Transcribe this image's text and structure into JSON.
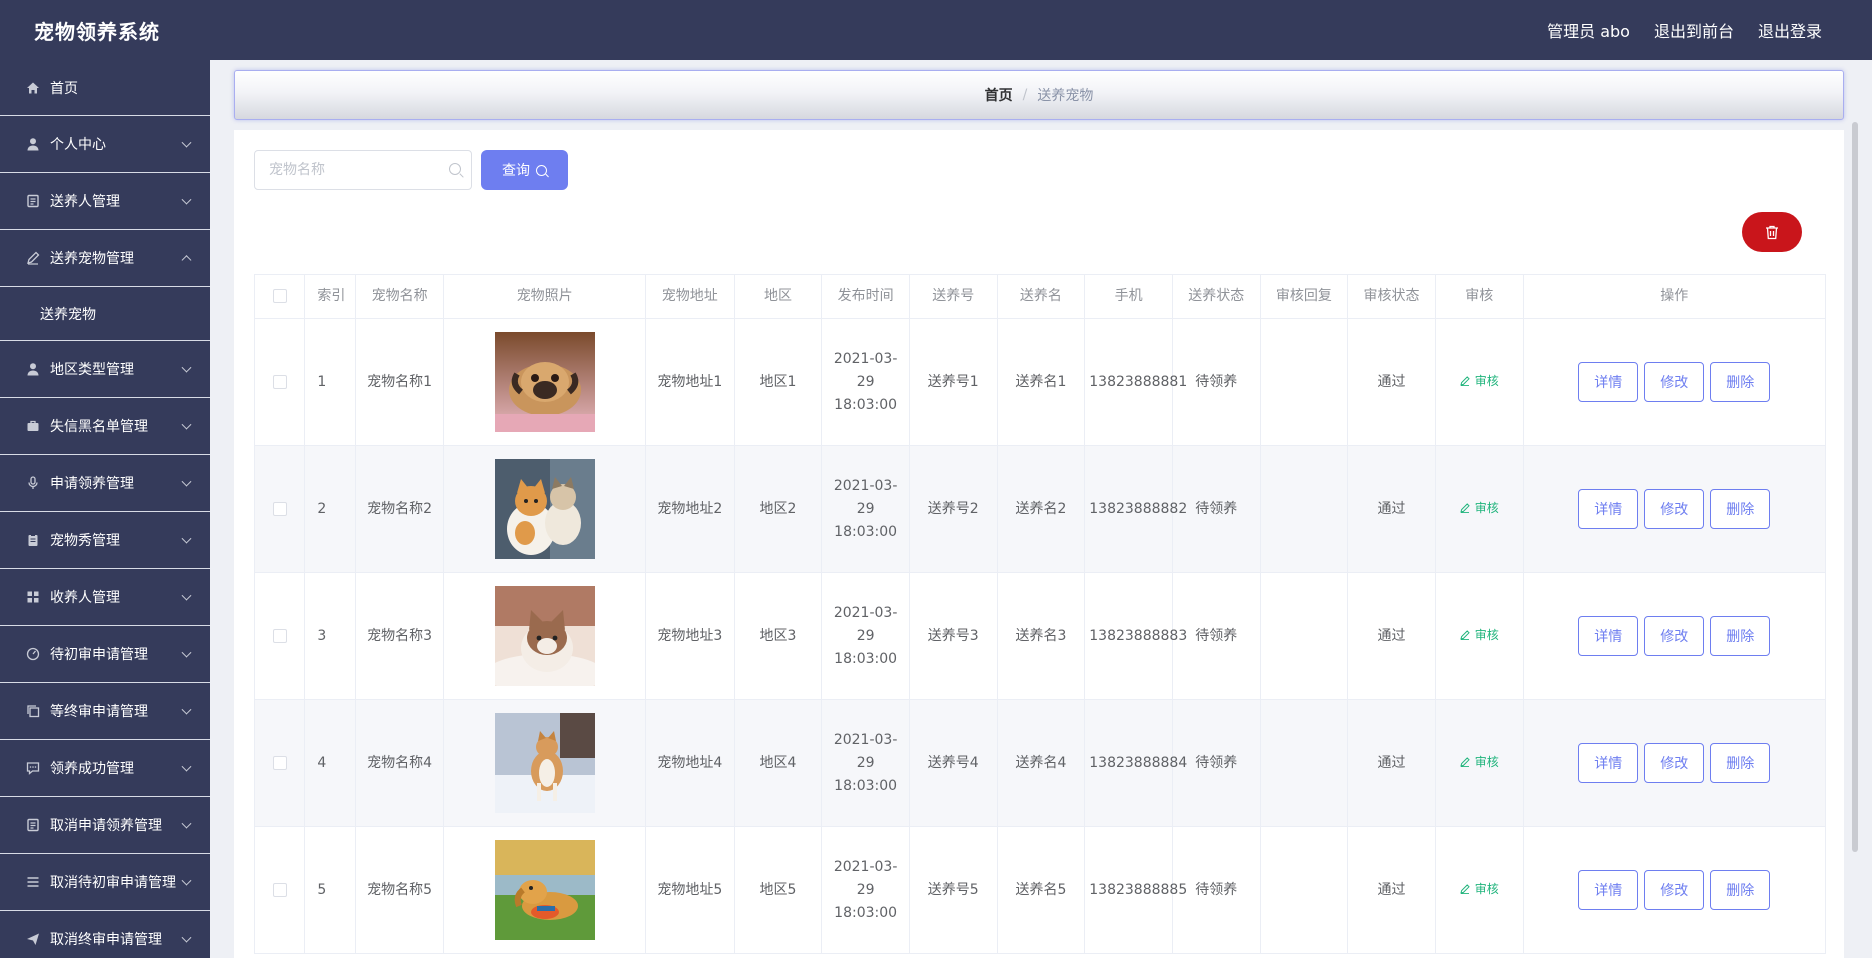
{
  "header": {
    "brand": "宠物领养系统",
    "admin_label": "管理员 abo",
    "to_front_label": "退出到前台",
    "logout_label": "退出登录"
  },
  "sidebar": {
    "items": [
      {
        "label": "首页",
        "icon": "home-icon"
      },
      {
        "label": "个人中心",
        "icon": "user-icon"
      },
      {
        "label": "送养人管理",
        "icon": "id-card-icon"
      },
      {
        "label": "送养宠物管理",
        "icon": "edit-icon",
        "expanded": true,
        "children": [
          {
            "label": "送养宠物"
          }
        ]
      },
      {
        "label": "地区类型管理",
        "icon": "user-icon"
      },
      {
        "label": "失信黑名单管理",
        "icon": "briefcase-icon"
      },
      {
        "label": "申请领养管理",
        "icon": "microphone-icon"
      },
      {
        "label": "宠物秀管理",
        "icon": "clipboard-icon"
      },
      {
        "label": "收养人管理",
        "icon": "grid-icon"
      },
      {
        "label": "待初审申请管理",
        "icon": "gauge-icon"
      },
      {
        "label": "等终审申请管理",
        "icon": "copy-icon"
      },
      {
        "label": "领养成功管理",
        "icon": "chat-icon"
      },
      {
        "label": "取消申请领养管理",
        "icon": "id-card-icon"
      },
      {
        "label": "取消待初审申请管理",
        "icon": "list-icon"
      },
      {
        "label": "取消终审申请管理",
        "icon": "send-icon"
      }
    ]
  },
  "breadcrumb": {
    "home": "首页",
    "separator": "/",
    "current": "送养宠物"
  },
  "search": {
    "placeholder": "宠物名称",
    "button_label": "查询"
  },
  "table": {
    "columns": [
      "索引",
      "宠物名称",
      "宠物照片",
      "宠物地址",
      "地区",
      "发布时间",
      "送养号",
      "送养名",
      "手机",
      "送养状态",
      "审核回复",
      "审核状态",
      "审核",
      "操作"
    ],
    "audit_label": "审核",
    "actions": {
      "detail": "详情",
      "edit": "修改",
      "delete": "删除"
    },
    "rows": [
      {
        "index": "1",
        "name": "宠物名称1",
        "photo": "pug",
        "address": "宠物地址1",
        "region": "地区1",
        "time": "2021-03-29 18:03:00",
        "send_no": "送养号1",
        "send_name": "送养名1",
        "phone": "13823888881",
        "status": "待领养",
        "reply": "",
        "audit_status": "通过"
      },
      {
        "index": "2",
        "name": "宠物名称2",
        "photo": "cats",
        "address": "宠物地址2",
        "region": "地区2",
        "time": "2021-03-29 18:03:00",
        "send_no": "送养号2",
        "send_name": "送养名2",
        "phone": "13823888882",
        "status": "待领养",
        "reply": "",
        "audit_status": "通过"
      },
      {
        "index": "3",
        "name": "宠物名称3",
        "photo": "kitten",
        "address": "宠物地址3",
        "region": "地区3",
        "time": "2021-03-29 18:03:00",
        "send_no": "送养号3",
        "send_name": "送养名3",
        "phone": "13823888883",
        "status": "待领养",
        "reply": "",
        "audit_status": "通过"
      },
      {
        "index": "4",
        "name": "宠物名称4",
        "photo": "shiba",
        "address": "宠物地址4",
        "region": "地区4",
        "time": "2021-03-29 18:03:00",
        "send_no": "送养号4",
        "send_name": "送养名4",
        "phone": "13823888884",
        "status": "待领养",
        "reply": "",
        "audit_status": "通过"
      },
      {
        "index": "5",
        "name": "宠物名称5",
        "photo": "retriever",
        "address": "宠物地址5",
        "region": "地区5",
        "time": "2021-03-29 18:03:00",
        "send_no": "送养号5",
        "send_name": "送养名5",
        "phone": "13823888885",
        "status": "待领养",
        "reply": "",
        "audit_status": "通过"
      }
    ]
  },
  "colors": {
    "header_bg": "#353b5b",
    "primary": "#6e7ef0",
    "danger": "#c9151b",
    "success": "#20b47c"
  }
}
